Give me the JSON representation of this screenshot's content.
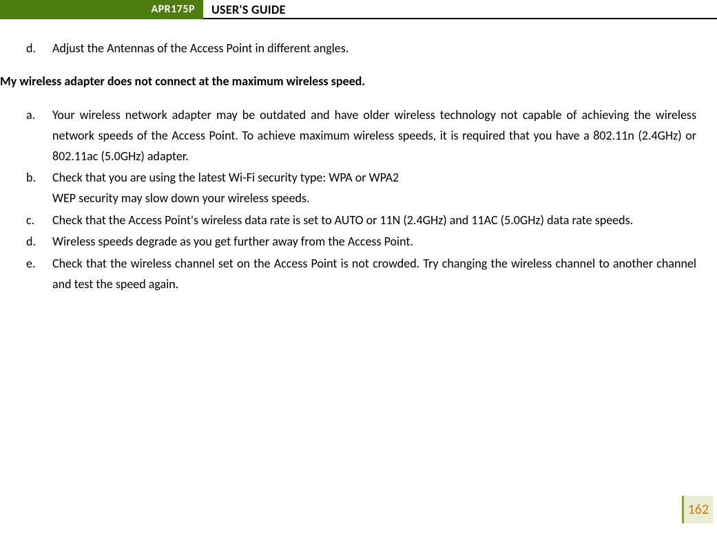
{
  "header": {
    "model": "APR175P",
    "title": "USER'S GUIDE"
  },
  "top_item": {
    "marker": "d.",
    "text": "Adjust the Antennas of the Access Point in different angles."
  },
  "section_heading": "My wireless adapter does not connect at the maximum wireless speed.",
  "items": [
    {
      "marker": "a.",
      "text": "Your wireless network adapter may be outdated and have older wireless technology not capable of achieving the wireless network speeds of the Access Point. To achieve maximum wireless speeds, it is required that you have a 802.11n (2.4GHz) or 802.11ac (5.0GHz) adapter.",
      "justify": true
    },
    {
      "marker": "b.",
      "line1": "Check that you are using the latest Wi-Fi security type: WPA or WPA2",
      "line2": "WEP security may slow down your wireless speeds."
    },
    {
      "marker": "c.",
      "text": "Check that the Access Point's wireless data rate is set to AUTO or 11N (2.4GHz) and 11AC (5.0GHz) data rate speeds."
    },
    {
      "marker": "d.",
      "text": "Wireless speeds degrade as you get further away from the Access Point."
    },
    {
      "marker": "e.",
      "text": "Check that the wireless channel set on the Access Point is not crowded.  Try changing the wireless channel to another channel and test the speed again.",
      "justify": true
    }
  ],
  "page_number": "162"
}
